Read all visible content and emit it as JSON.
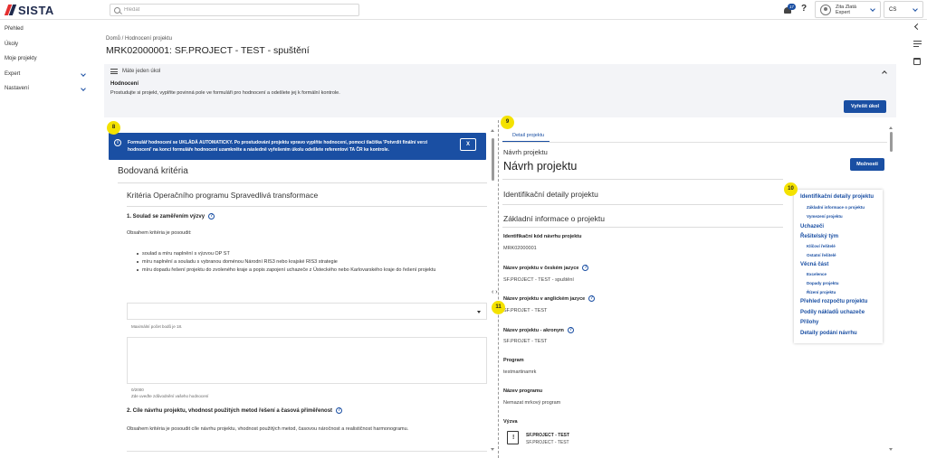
{
  "header": {
    "logo_text": "SISTA",
    "search_placeholder": "Hledat",
    "notification_count": "17",
    "help_label": "?",
    "user_name": "Zita Zlatá",
    "user_role": "Expert",
    "language": "CS"
  },
  "sidebar": {
    "items": [
      {
        "label": "Přehled"
      },
      {
        "label": "Úkoly"
      },
      {
        "label": "Moje projekty"
      },
      {
        "label": "Expert"
      },
      {
        "label": "Nastavení"
      }
    ]
  },
  "page": {
    "breadcrumb": "Domů  /  Hodnocení projektu",
    "title": "MRK02000001: SF.PROJECT - TEST - spuštění"
  },
  "task": {
    "header": "Máte jeden úkol",
    "title": "Hodnocení",
    "description": "Prostudujte si projekt, vyplňte povinná pole ve formuláři pro hodnocení a odešlete jej k formální kontrole.",
    "button": "Vyřešit úkol"
  },
  "steps": [
    "8",
    "9",
    "10",
    "11"
  ],
  "left": {
    "banner_text": "Formulář hodnocení se UKLÁDÁ AUTOMATICKY. Po prostudování projektu vpravo vyplňte hodnocení, pomocí tlačítka 'Potvrdit finální verzi hodnocení' na konci formuláře hodnocení uzamkněte a následně vyřešením úkolu odešlete referentovi TA ČR ke kontrole.",
    "banner_close": "X",
    "section_title": "Bodovaná kritéria",
    "sub_title": "Kritéria Operačního programu Spravedlivá transformace",
    "criterion1_title": "1. Soulad se zaměřením výzvy",
    "criterion1_intro": "Obsahem kritéria je posoudit:",
    "bullets": [
      "soulad a míru naplnění s výzvou OP ST",
      "míru naplnění a souladu s vybranou doménou Národní RIS3 nebo krajské RIS3 strategie",
      "míru dopadu řešení projektu do zvoleného kraje a popis zapojení uchazeče z Ústeckého nebo Karlovarského kraje do řešení projektu"
    ],
    "max_points_text": "Maximální počet bodů je 18.",
    "char_count": "0/2000",
    "justification_hint": "Zde uveďte zdůvodnění vašeho hodnocení",
    "criterion2_title": "2. Cíle návrhu projektu, vhodnost použitých metod řešení a časová přiměřenost",
    "criterion2_intro": "Obsahem kritéria je posoudit cíle návrhu projektu, vhodnost použitých metod, časovou náročnost a realističnost harmonogramu."
  },
  "right": {
    "tab": "Detail projektu",
    "subhead": "Návrh projektu",
    "title": "Návrh projektu",
    "options_button": "Možnosti",
    "section_identification": "Identifikační detaily projektu",
    "section_basic": "Základní informace o projektu",
    "fields": [
      {
        "label": "Identifikační kód návrhu projektu",
        "value": "MRK02000001",
        "help": false
      },
      {
        "label": "Název projektu v českém jazyce",
        "value": "SF.PROJECT - TEST - spuštění",
        "help": true
      },
      {
        "label": "Název projektu v anglickém jazyce",
        "value": "SF.PROJET - TEST",
        "help": true
      },
      {
        "label": "Název projektu - akronym",
        "value": "SF.PROJET - TEST",
        "help": true
      },
      {
        "label": "Program",
        "value": "testmartinamrk",
        "help": false
      },
      {
        "label": "Název programu",
        "value": "Nemazat mrkový program",
        "help": false
      }
    ],
    "vyzva_label": "Výzva",
    "vyzva_line1": "SF.PROJECT - TEST",
    "vyzva_line2": "SF.PROJECT - TEST"
  },
  "toc": {
    "items": [
      {
        "label": "Identifikační detaily projektu",
        "level": 1
      },
      {
        "label": "Základní informace o projektu",
        "level": 2
      },
      {
        "label": "Vymezení projektu",
        "level": 2
      },
      {
        "label": "Uchazeči",
        "level": 1
      },
      {
        "label": "Řešitelský tým",
        "level": 1
      },
      {
        "label": "Klíčoví řešitelé",
        "level": 2
      },
      {
        "label": "Ostatní řešitelé",
        "level": 2
      },
      {
        "label": "Věcná část",
        "level": 1
      },
      {
        "label": "Excelence",
        "level": 2
      },
      {
        "label": "Dopady projektu",
        "level": 2
      },
      {
        "label": "Řízení projektu",
        "level": 2
      },
      {
        "label": "Přehled rozpočtu projektu",
        "level": 1
      },
      {
        "label": "Podíly nákladů uchazeče",
        "level": 1
      },
      {
        "label": "Přílohy",
        "level": 1
      },
      {
        "label": "Detaily podání návrhu",
        "level": 1
      }
    ]
  },
  "colors": {
    "primary": "#1a4fa3",
    "step_badge": "#f4e200",
    "brand_red": "#e53030",
    "brand_navy": "#1f2a4d"
  }
}
